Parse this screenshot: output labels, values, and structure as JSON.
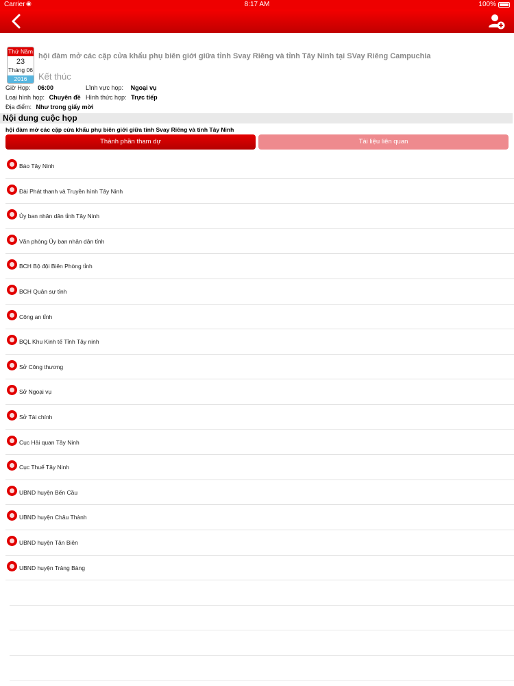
{
  "status_bar": {
    "carrier": "Carrier",
    "time": "8:17 AM",
    "battery": "100%"
  },
  "nav": {
    "back_icon": "back-chevron-icon",
    "action_icon": "user-add-icon"
  },
  "calendar": {
    "weekday": "Thứ Năm",
    "day": "23",
    "month": "Tháng 06",
    "year": "2016"
  },
  "meeting": {
    "title": "hội đàm mở các cặp cửa khẩu phụ biên giới giữa tỉnh Svay Riêng và tỉnh Tây Ninh tại SVay Riêng Campuchia",
    "status": "Kết thúc",
    "time_label": "Giờ Họp:",
    "time_value": "06:00",
    "field_label": "Lĩnh vực họp:",
    "field_value": "Ngoại vụ",
    "type_label": "Loại hình họp:",
    "type_value": "Chuyên đề",
    "form_label": "Hình thức họp:",
    "form_value": "Trực tiếp",
    "location_label": "Địa điểm:",
    "location_value": "Như trong giấy mời"
  },
  "section": {
    "title": "Nội dung cuộc họp",
    "subject": "hội đàm mở các cặp cửa khẩu phụ biên giới giữa tỉnh Svay Riêng và tỉnh Tây Ninh"
  },
  "tabs": [
    {
      "label": "Thành phần tham dự",
      "active": true
    },
    {
      "label": "Tài liệu liên quan",
      "active": false
    }
  ],
  "attendees": [
    "Báo Tây Ninh",
    "Đài Phát thanh và Truyền hình Tây Ninh",
    "Ủy ban nhân dân tỉnh Tây Ninh",
    "Văn phòng Ủy ban nhân dân tỉnh",
    "BCH Bộ đội Biên Phòng tỉnh",
    "BCH Quân sự tỉnh",
    "Công an tỉnh",
    "BQL Khu Kinh tế Tỉnh Tây ninh",
    "Sở Công thương",
    "Sở Ngoại vụ",
    "Sở Tài chính",
    "Cục Hải quan Tây Ninh",
    "Cục Thuế Tây Ninh",
    "UBND huyện Bến Cầu",
    "UBND huyện Châu Thành",
    "UBND huyện Tân Biên",
    "UBND huyện Trảng Bàng"
  ],
  "colors": {
    "accent": "#e00000",
    "tab_inactive": "#ee8a8e",
    "calendar_year": "#58b6df"
  }
}
